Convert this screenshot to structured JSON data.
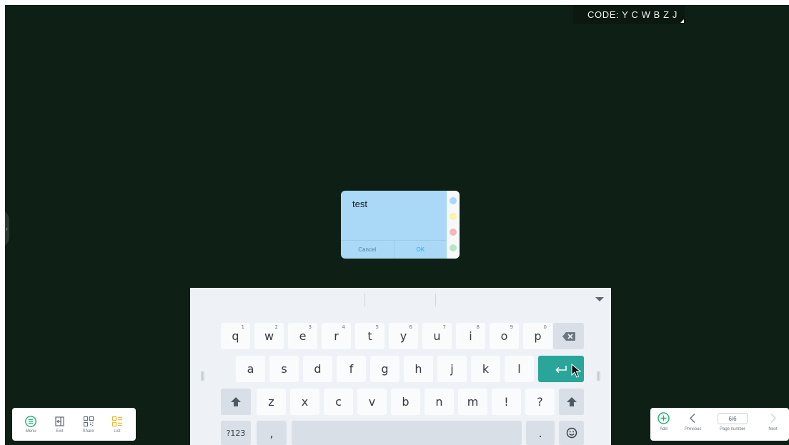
{
  "banner": {
    "code_text": "CODE: Y C W B Z J"
  },
  "note": {
    "text": "test",
    "cancel_label": "Cancel",
    "ok_label": "OK",
    "palette": [
      "#a9d9f7",
      "#fbf3a8",
      "#f6b7b9",
      "#b8e6c2"
    ]
  },
  "keyboard": {
    "row1": [
      {
        "char": "q",
        "num": "1"
      },
      {
        "char": "w",
        "num": "2"
      },
      {
        "char": "e",
        "num": "3"
      },
      {
        "char": "r",
        "num": "4"
      },
      {
        "char": "t",
        "num": "5"
      },
      {
        "char": "y",
        "num": "6"
      },
      {
        "char": "u",
        "num": "7"
      },
      {
        "char": "i",
        "num": "8"
      },
      {
        "char": "o",
        "num": "9"
      },
      {
        "char": "p",
        "num": "0"
      }
    ],
    "row2": [
      "a",
      "s",
      "d",
      "f",
      "g",
      "h",
      "j",
      "k",
      "l"
    ],
    "row3": [
      "z",
      "x",
      "c",
      "v",
      "b",
      "n",
      "m",
      "!",
      "?"
    ],
    "symbols_label": "?123",
    "comma_label": ",",
    "period_label": ".",
    "backspace_icon": "backspace-icon",
    "enter_icon": "enter-icon",
    "accent": "#2aa59a"
  },
  "left_toolbar": {
    "menu_label": "Menu",
    "exit_label": "Exit",
    "share_label": "Share",
    "list_label": "List"
  },
  "right_toolbar": {
    "add_label": "Add",
    "previous_label": "Previous",
    "page_value": "6/6",
    "page_label": "Page number",
    "next_label": "Next"
  },
  "colors": {
    "board": "#0e2016",
    "accent_green": "#1db36a",
    "list_yellow": "#f2b52c"
  }
}
